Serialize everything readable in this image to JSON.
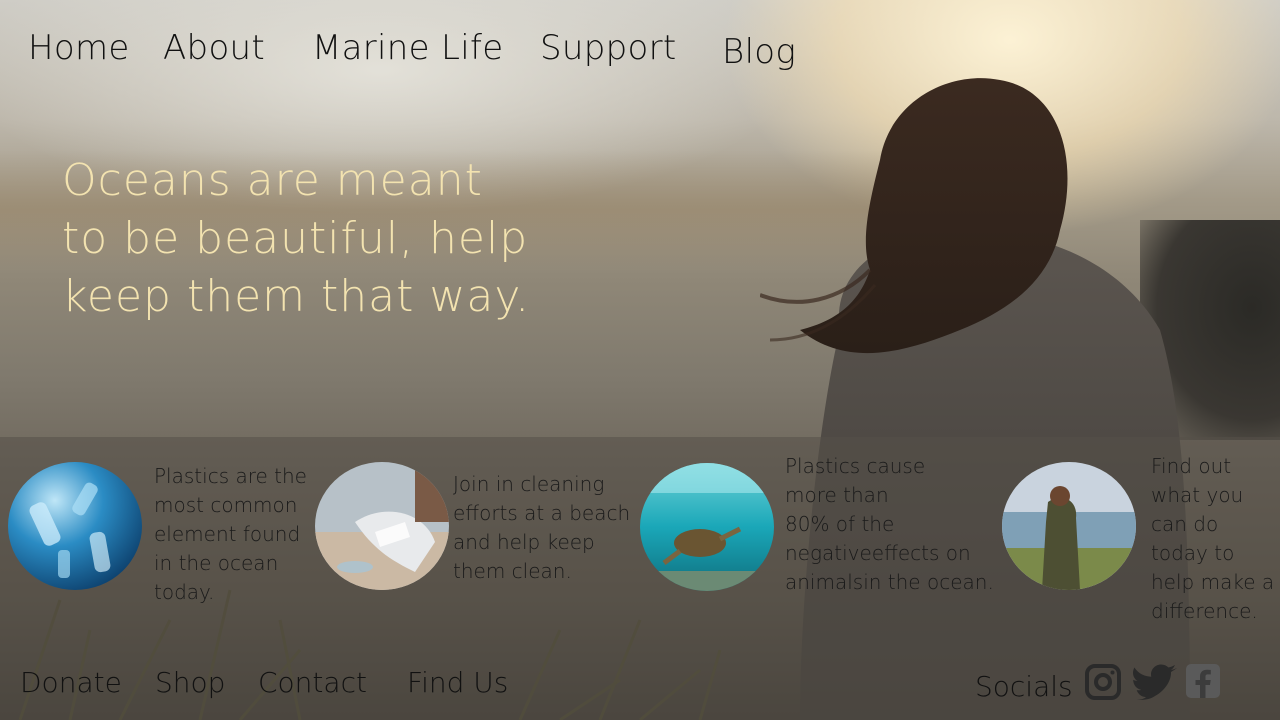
{
  "nav": {
    "items": [
      {
        "label": "Home"
      },
      {
        "label": "About"
      },
      {
        "label": "Marine Life"
      },
      {
        "label": "Support"
      },
      {
        "label": "Blog"
      }
    ]
  },
  "hero": {
    "line1": "Oceans are meant",
    "line2": "to be beautiful, help",
    "line3": "keep them that way."
  },
  "cards": [
    {
      "image": "plastic-bottles-underwater",
      "lines": [
        "Plastics are the",
        "most common",
        "element found",
        "in the ocean",
        "today."
      ]
    },
    {
      "image": "beach-cleanup-gloved-hand",
      "lines": [
        "Join in cleaning",
        "efforts at a beach",
        "and help keep",
        "them clean."
      ]
    },
    {
      "image": "sea-turtle-underwater",
      "lines": [
        "Plastics cause",
        "more than",
        "80% of the",
        "negativeeffects on",
        "animalsin the ocean."
      ]
    },
    {
      "image": "woman-at-coast",
      "lines": [
        "Find out",
        "what you",
        "can do",
        "today to",
        "help make a",
        "difference."
      ]
    }
  ],
  "footer": {
    "links": [
      {
        "label": "Donate"
      },
      {
        "label": "Shop"
      },
      {
        "label": "Contact"
      },
      {
        "label": "Find Us"
      }
    ],
    "socials_label": "Socials",
    "social_icons": [
      "instagram-icon",
      "twitter-icon",
      "facebook-icon"
    ]
  },
  "colors": {
    "hero_text": "#f3e3b0",
    "nav_text": "#111111",
    "band_overlay": "rgba(85,80,72,0.55)",
    "icon_gray": "#2a2a2a"
  }
}
